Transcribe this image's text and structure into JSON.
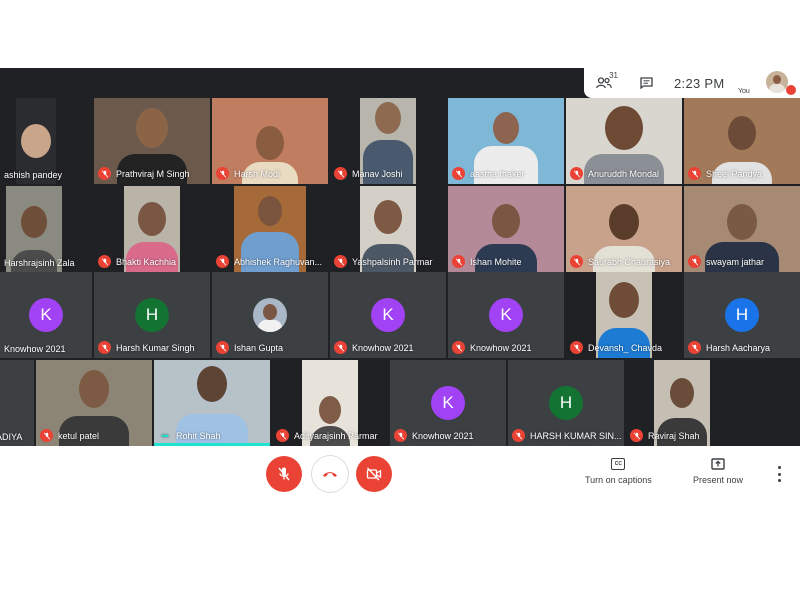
{
  "topbar": {
    "participant_count": "31",
    "time": "2:23  PM",
    "self_label": "You"
  },
  "tiles": {
    "r1c1": {
      "name": "ashish pandey"
    },
    "r1c2": {
      "name": "Prathviraj M Singh"
    },
    "r1c3": {
      "name": "Harsh Modi"
    },
    "r1c4": {
      "name": "Manav Joshi"
    },
    "r1c5": {
      "name": "aastha thaker"
    },
    "r1c6": {
      "name": "Anuruddh Mondal"
    },
    "r1c7": {
      "name": "Sheel Pandya"
    },
    "r2c1": {
      "name": "Harshrajsinh Zala"
    },
    "r2c2": {
      "name": "Bhakti Kachhia"
    },
    "r2c3": {
      "name": "Abhishek Raghuvan..."
    },
    "r2c4": {
      "name": "Yashpalsinh Parmar"
    },
    "r2c5": {
      "name": "Ishan Mohite"
    },
    "r2c6": {
      "name": "Saurabh Chaurasiya"
    },
    "r2c7": {
      "name": "swayam jathar"
    },
    "r3c1": {
      "name": "Knowhow 2021",
      "letter": "K"
    },
    "r3c2": {
      "name": "Harsh Kumar Singh",
      "letter": "H"
    },
    "r3c3": {
      "name": "Ishan Gupta"
    },
    "r3c4": {
      "name": "Knowhow 2021",
      "letter": "K"
    },
    "r3c5": {
      "name": "Knowhow 2021",
      "letter": "K"
    },
    "r3c6": {
      "name": "Devansh_ Chavda"
    },
    "r3c7": {
      "name": "Harsh Aacharya",
      "letter": "H"
    },
    "r4c1": {
      "name": "ADIYA"
    },
    "r4c2": {
      "name": "ketul patel"
    },
    "r4c3": {
      "name": "Rohit Shah"
    },
    "r4c4": {
      "name": "Adityarajsinh Parmar"
    },
    "r4c5": {
      "name": "Knowhow 2021",
      "letter": "K"
    },
    "r4c6": {
      "name": "HARSH KUMAR SIN...",
      "letter": "H"
    },
    "r4c7": {
      "name": "Raviraj Shah"
    }
  },
  "controls": {
    "captions_label": "Turn on captions",
    "captions_icon": "CC",
    "present_label": "Present now"
  },
  "colors": {
    "meet_bg": "#202124",
    "tile_bg": "#3c4043",
    "mic_red": "#ea4335",
    "avatar_purple": "#a142f4",
    "avatar_green": "#137333",
    "avatar_blue": "#1a73e8",
    "speaking_teal": "#1ee3cf"
  }
}
